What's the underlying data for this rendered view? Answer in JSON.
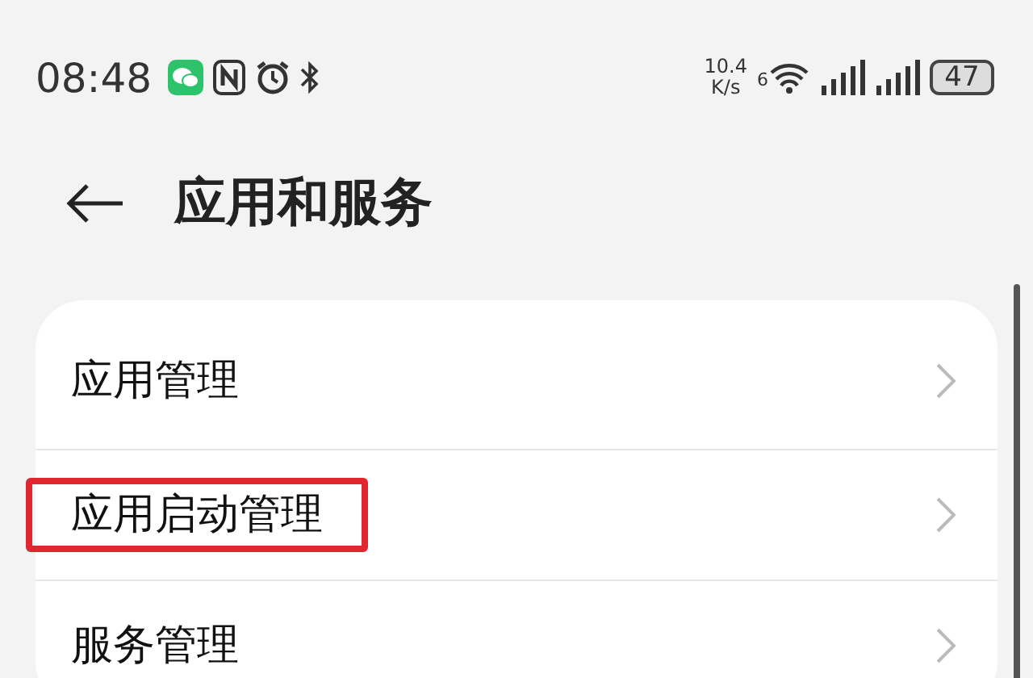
{
  "status_bar": {
    "time": "08:48",
    "net_speed": "10.4",
    "net_speed_unit": "K/s",
    "wifi_standard": "6",
    "battery": "47"
  },
  "header": {
    "title": "应用和服务"
  },
  "items": [
    {
      "label": "应用管理",
      "highlighted": false
    },
    {
      "label": "应用启动管理",
      "highlighted": true
    },
    {
      "label": "服务管理",
      "highlighted": false
    }
  ]
}
